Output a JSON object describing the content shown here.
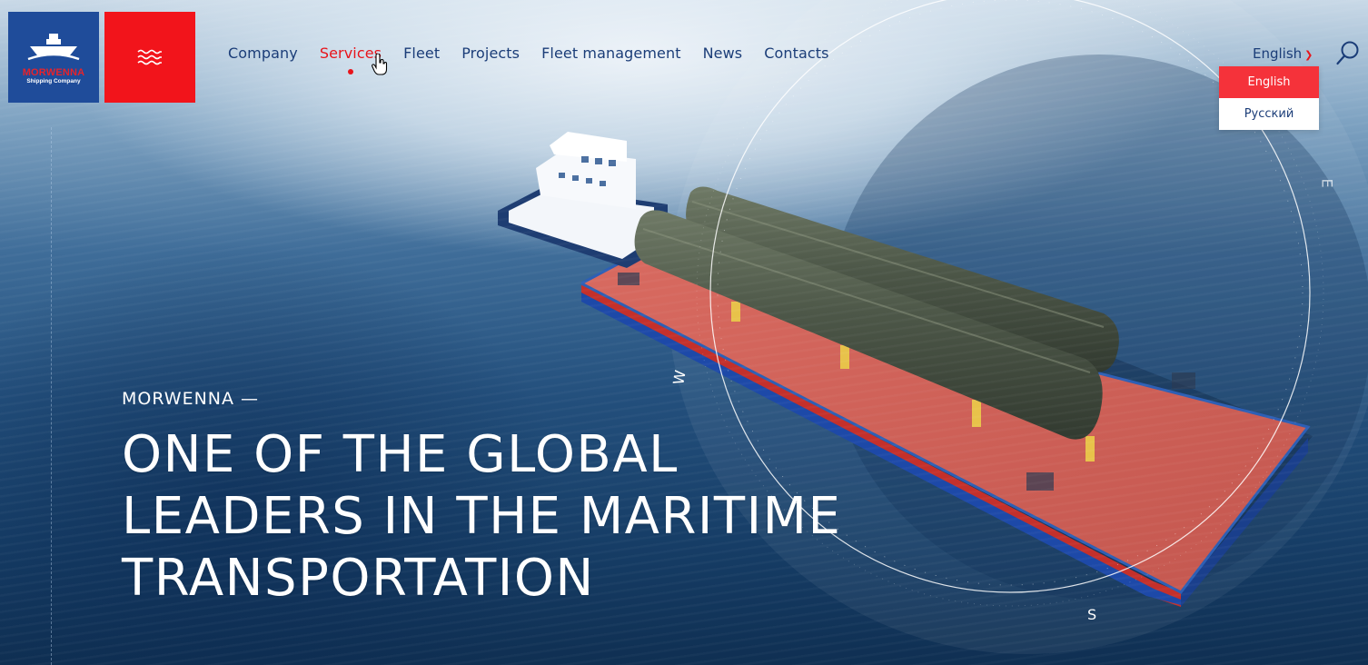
{
  "brand": {
    "name": "MORWENNA",
    "tagline": "Shipping Company",
    "colors": {
      "primary_blue": "#1f4c9a",
      "accent_red": "#f2141b",
      "nav_text": "#1b3d78"
    }
  },
  "menu_button": {
    "icon": "waves-menu-icon"
  },
  "nav": {
    "items": [
      {
        "label": "Company",
        "active": false
      },
      {
        "label": "Services",
        "active": true
      },
      {
        "label": "Fleet",
        "active": false
      },
      {
        "label": "Projects",
        "active": false
      },
      {
        "label": "Fleet management",
        "active": false
      },
      {
        "label": "News",
        "active": false
      },
      {
        "label": "Contacts",
        "active": false
      }
    ]
  },
  "language": {
    "current": "English",
    "options": [
      {
        "label": "English",
        "selected": true
      },
      {
        "label": "Русский",
        "selected": false
      }
    ]
  },
  "search": {
    "icon": "search-icon"
  },
  "hero": {
    "eyebrow": "MORWENNA —",
    "headline_lines": [
      "ONE OF THE GLOBAL",
      "LEADERS IN THE MARITIME",
      "TRANSPORTATION"
    ]
  },
  "compass": {
    "west": "W",
    "south": "S",
    "east": "E"
  }
}
